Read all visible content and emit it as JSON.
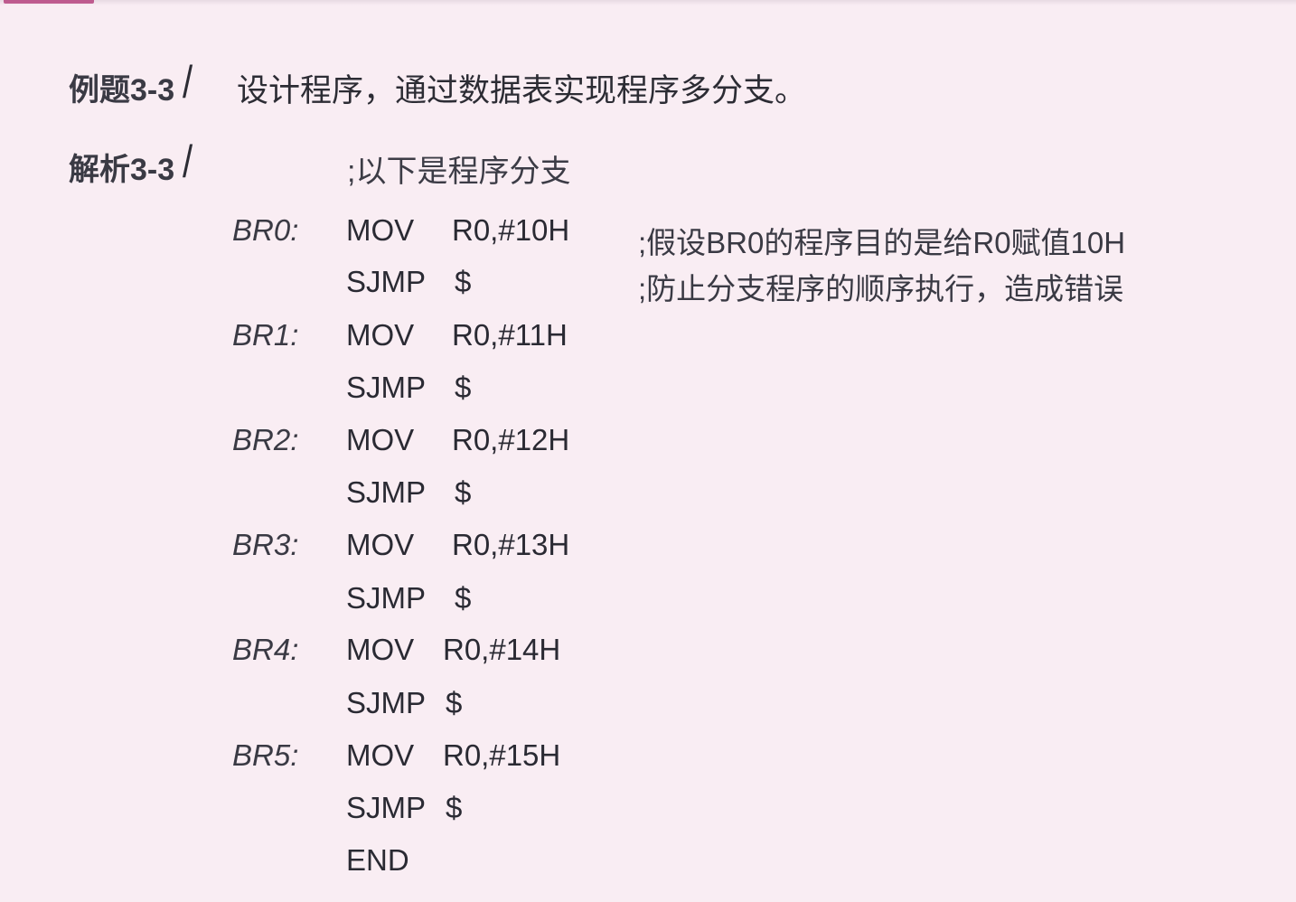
{
  "example": {
    "label": "例题3-3",
    "slash": "/",
    "text": "设计程序，通过数据表实现程序多分支。"
  },
  "analysis": {
    "label": "解析3-3",
    "slash": "/",
    "header_comment": ";以下是程序分支"
  },
  "code": [
    {
      "label": "BR0:",
      "op": "MOV",
      "arg": "R0,#10H",
      "comment": ";假设BR0的程序目的是给R0赋值10H"
    },
    {
      "label": "",
      "op": "SJMP",
      "arg": "$",
      "comment": ";防止分支程序的顺序执行，造成错误"
    },
    {
      "label": "BR1:",
      "op": "MOV",
      "arg": "R0,#11H",
      "comment": ""
    },
    {
      "label": "",
      "op": "SJMP",
      "arg": "$",
      "comment": ""
    },
    {
      "label": "BR2:",
      "op": "MOV",
      "arg": "R0,#12H",
      "comment": ""
    },
    {
      "label": "",
      "op": "SJMP",
      "arg": "$",
      "comment": ""
    },
    {
      "label": "BR3:",
      "op": "MOV",
      "arg": "R0,#13H",
      "comment": ""
    },
    {
      "label": "",
      "op": "SJMP",
      "arg": "$",
      "comment": ""
    },
    {
      "label": "BR4:",
      "op": "MOV",
      "arg": "R0,#14H",
      "comment": ""
    },
    {
      "label": "",
      "op": "SJMP",
      "arg": "$",
      "comment": ""
    },
    {
      "label": "BR5:",
      "op": "MOV",
      "arg": "R0,#15H",
      "comment": ""
    },
    {
      "label": "",
      "op": "SJMP",
      "arg": "$",
      "comment": ""
    },
    {
      "label": "",
      "op": "END",
      "arg": "",
      "comment": ""
    }
  ]
}
